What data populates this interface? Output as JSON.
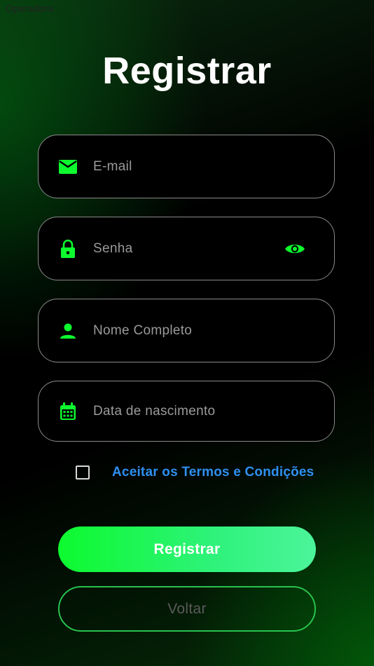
{
  "status_bar": {
    "carrier": "Operadora"
  },
  "title": "Registrar",
  "form": {
    "email": {
      "placeholder": "E-mail",
      "value": "",
      "icon": "mail-icon"
    },
    "password": {
      "placeholder": "Senha",
      "value": "",
      "icon": "lock-icon",
      "toggle_icon": "eye-icon"
    },
    "full_name": {
      "placeholder": "Nome Completo",
      "value": "",
      "icon": "person-icon"
    },
    "birth_date": {
      "placeholder": "Data de nascimento",
      "value": "",
      "icon": "calendar-icon"
    }
  },
  "terms": {
    "checked": false,
    "label": "Aceitar os Termos e Condições"
  },
  "buttons": {
    "register": "Registrar",
    "back": "Voltar"
  },
  "colors": {
    "accent_green": "#0dfa2f",
    "link_blue": "#2f8ff0",
    "field_border": "#8a8a8a",
    "background": "#000000"
  }
}
